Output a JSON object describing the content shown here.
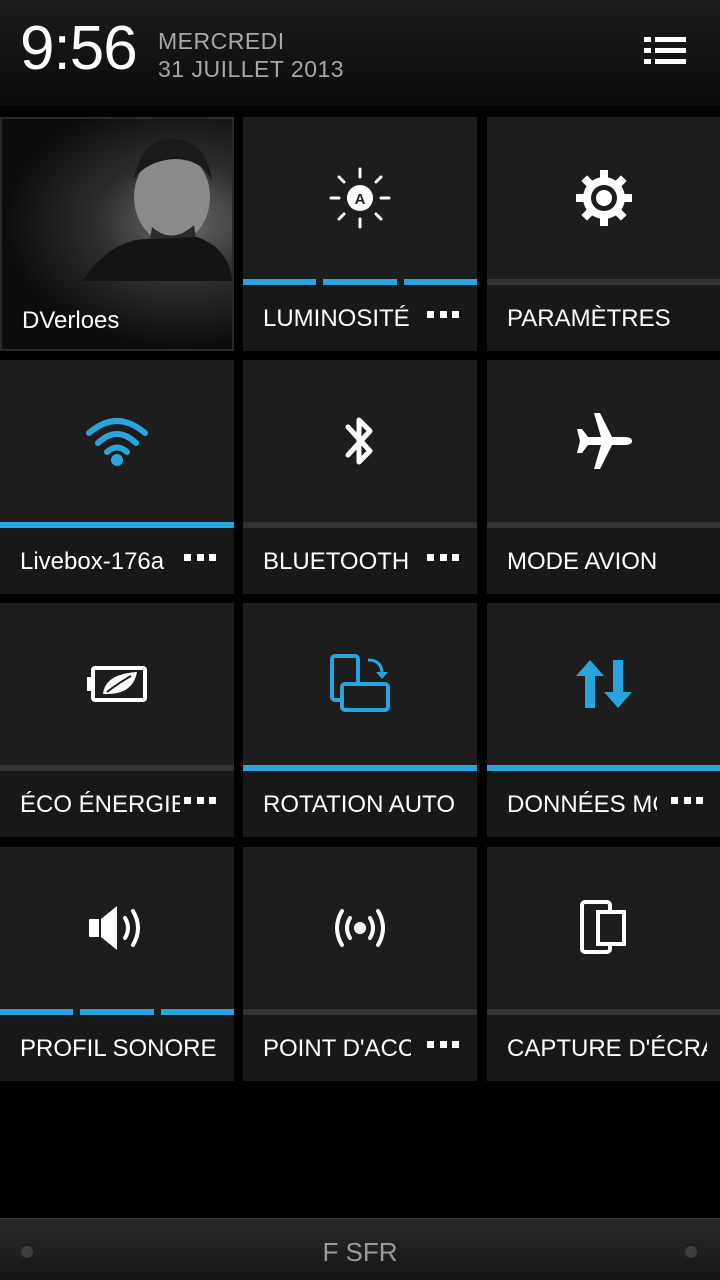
{
  "header": {
    "time": "9:56",
    "day": "MERCREDI",
    "date": "31 JUILLET 2013"
  },
  "tiles": [
    {
      "label": "DVerloes",
      "icon": "user-photo",
      "has_more": false,
      "state": "none"
    },
    {
      "label": "LUMINOSITÉ",
      "icon": "brightness-auto-icon",
      "has_more": true,
      "state": "segmented-3-of-3"
    },
    {
      "label": "PARAMÈTRES",
      "icon": "gear-icon",
      "has_more": false,
      "state": "off"
    },
    {
      "label": "Livebox-176a",
      "icon": "wifi-icon",
      "has_more": true,
      "state": "on"
    },
    {
      "label": "BLUETOOTH",
      "icon": "bluetooth-icon",
      "has_more": true,
      "state": "off"
    },
    {
      "label": "MODE AVION",
      "icon": "airplane-icon",
      "has_more": false,
      "state": "off"
    },
    {
      "label": "ÉCO ÉNERGIE",
      "icon": "eco-battery-icon",
      "has_more": true,
      "state": "off"
    },
    {
      "label": "ROTATION AUTO",
      "icon": "auto-rotate-icon",
      "has_more": false,
      "state": "on"
    },
    {
      "label": "DONNÉES MO",
      "icon": "mobile-data-icon",
      "has_more": true,
      "state": "on"
    },
    {
      "label": "PROFIL SONORE",
      "icon": "speaker-icon",
      "has_more": false,
      "state": "segmented-3-of-3"
    },
    {
      "label": "POINT D'ACCÈ",
      "icon": "hotspot-icon",
      "has_more": true,
      "state": "off"
    },
    {
      "label": "CAPTURE D'ÉCRAN",
      "icon": "screenshot-icon",
      "has_more": false,
      "state": "off"
    }
  ],
  "footer": {
    "carrier": "F SFR"
  },
  "colors": {
    "accent": "#2aa4dc",
    "tile": "#1d1d1d",
    "inactive_bar": "#333333"
  }
}
